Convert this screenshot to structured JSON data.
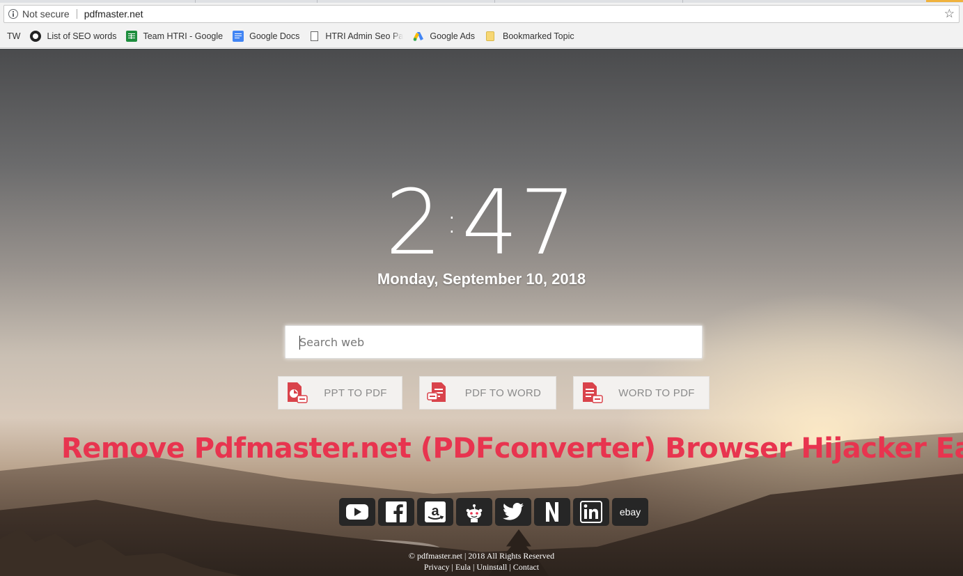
{
  "browser": {
    "security_label": "Not secure",
    "url": "pdfmaster.net",
    "bookmarks": [
      {
        "label": "TW",
        "icon": "none"
      },
      {
        "label": "List of SEO words",
        "icon": "github-icon"
      },
      {
        "label": "Team HTRI - Google",
        "icon": "google-sheets-icon"
      },
      {
        "label": "Google Docs",
        "icon": "google-docs-icon"
      },
      {
        "label": "HTRI Admin Seo Pane",
        "icon": "page-icon"
      },
      {
        "label": "Google Ads",
        "icon": "google-ads-icon"
      },
      {
        "label": "Bookmarked Topic",
        "icon": "folder-icon"
      }
    ]
  },
  "clock": {
    "hour": "2",
    "minute": "47",
    "date": "Monday, September 10, 2018"
  },
  "search": {
    "placeholder": "Search web"
  },
  "converters": [
    {
      "label": "PPT TO PDF",
      "icon": "ppt-to-pdf-icon"
    },
    {
      "label": "PDF TO WORD",
      "icon": "pdf-to-word-icon"
    },
    {
      "label": "WORD TO PDF",
      "icon": "word-to-pdf-icon"
    }
  ],
  "overlay_title": "Remove Pdfmaster.net (PDFconverter) Browser Hijacker Easily",
  "social": [
    {
      "name": "youtube-icon"
    },
    {
      "name": "facebook-icon"
    },
    {
      "name": "amazon-icon"
    },
    {
      "name": "reddit-icon"
    },
    {
      "name": "twitter-icon"
    },
    {
      "name": "netflix-icon"
    },
    {
      "name": "linkedin-icon"
    },
    {
      "name": "ebay-icon",
      "label": "ebay"
    }
  ],
  "footer": {
    "copyright": "© pdfmaster.net | 2018 All Rights Reserved",
    "privacy": "Privacy",
    "eula": "Eula",
    "uninstall": "Uninstall",
    "contact": "Contact",
    "separator": " | "
  },
  "colors": {
    "overlay_title": "#e8344f",
    "converter_icon": "#d9434b",
    "social_bg": "#262626"
  }
}
